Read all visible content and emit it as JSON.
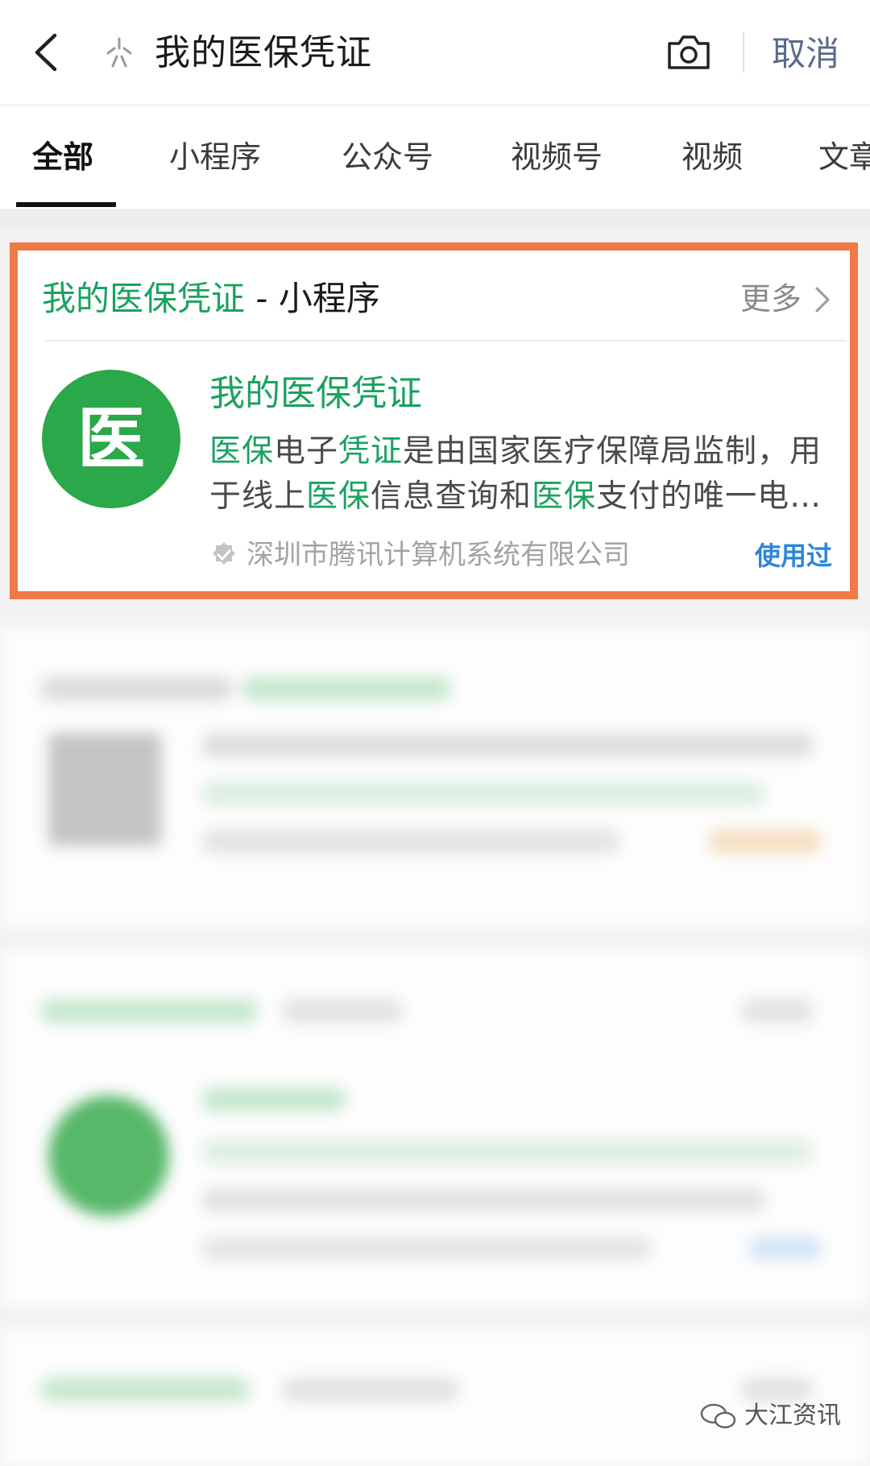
{
  "search": {
    "query": "我的医保凭证",
    "cancel_label": "取消"
  },
  "tabs": [
    {
      "label": "全部",
      "active": true
    },
    {
      "label": "小程序"
    },
    {
      "label": "公众号"
    },
    {
      "label": "视频号"
    },
    {
      "label": "视频"
    },
    {
      "label": "文章"
    }
  ],
  "result_card": {
    "title_keyword": "我的医保凭证",
    "title_suffix": " - 小程序",
    "more_label": "更多",
    "app_icon_char": "医",
    "app_name": "我的医保凭证",
    "description_segments": [
      {
        "text": "医保",
        "hl": true
      },
      {
        "text": "电子",
        "hl": false
      },
      {
        "text": "凭证",
        "hl": true
      },
      {
        "text": "是由国家医疗保障局监制，用",
        "hl": false
      }
    ],
    "description_segments_line2": [
      {
        "text": "于线上",
        "hl": false
      },
      {
        "text": "医保",
        "hl": true
      },
      {
        "text": "信息查询和",
        "hl": false
      },
      {
        "text": "医保",
        "hl": true
      },
      {
        "text": "支付的唯一电…",
        "hl": false
      }
    ],
    "publisher": "深圳市腾讯计算机系统有限公司",
    "used_label": "使用过"
  },
  "watermark": "大江资讯",
  "colors": {
    "highlight": "#1aa260",
    "border": "#f07a45",
    "link": "#2b86d9",
    "icon_bg": "#2aa84a"
  }
}
